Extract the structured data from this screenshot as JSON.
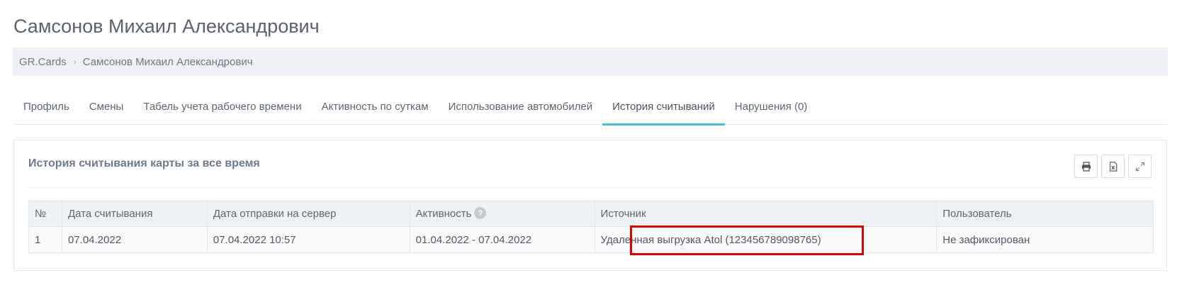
{
  "page": {
    "title": "Самсонов Михаил Александрович"
  },
  "breadcrumb": {
    "root": "GR.Cards",
    "separator": "›",
    "current": "Самсонов Михаил Александрович"
  },
  "tabs": [
    {
      "label": "Профиль"
    },
    {
      "label": "Смены"
    },
    {
      "label": "Табель учета рабочего времени"
    },
    {
      "label": "Активность по суткам"
    },
    {
      "label": "Использование автомобилей"
    },
    {
      "label": "История считываний",
      "active": true
    },
    {
      "label": "Нарушения (0)"
    }
  ],
  "panel": {
    "title": "История считывания карты за все время",
    "toolbar": {
      "print_icon": "print-icon",
      "excel_icon": "excel-export-icon",
      "expand_icon": "expand-icon"
    }
  },
  "table": {
    "headers": {
      "num": "№",
      "read_date": "Дата считывания",
      "sent_date": "Дата отправки на сервер",
      "activity": "Активность",
      "activity_help": "?",
      "source": "Источник",
      "user": "Пользователь"
    },
    "rows": [
      {
        "num": "1",
        "read_date": "07.04.2022",
        "sent_date": "07.04.2022 10:57",
        "activity": "01.04.2022 - 07.04.2022",
        "source": "Удаленная выгрузка Atol (123456789098765)",
        "user": "Не зафиксирован"
      }
    ]
  },
  "colors": {
    "active_tab_underline": "#4bbcd1",
    "highlight": "#d40000"
  }
}
